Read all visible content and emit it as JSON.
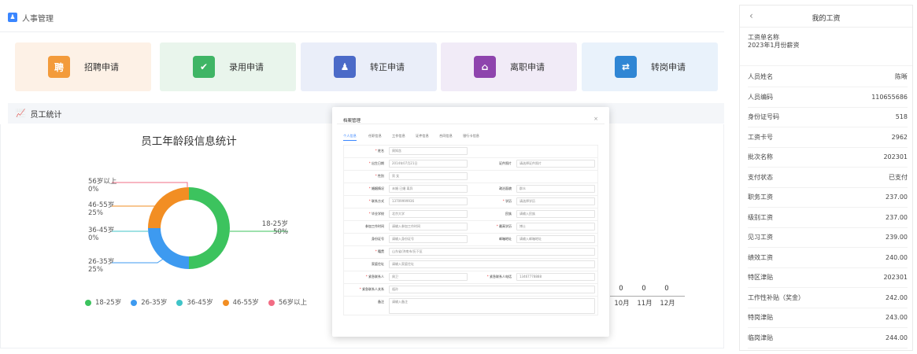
{
  "header": {
    "title": "人事管理"
  },
  "cards": [
    {
      "label": "招聘申请",
      "icon": "聘",
      "icon_name": "recruit-icon",
      "bg": "#fdf1e6",
      "color": "#f39b3b"
    },
    {
      "label": "录用申请",
      "icon": "✔",
      "icon_name": "check-icon",
      "bg": "#e9f5ec",
      "color": "#3fb565"
    },
    {
      "label": "转正申请",
      "icon": "♟",
      "icon_name": "user-icon",
      "bg": "#eaeef9",
      "color": "#4b6ac8"
    },
    {
      "label": "离职申请",
      "icon": "⌂",
      "icon_name": "leave-icon",
      "bg": "#f1ebf7",
      "color": "#8e44ad"
    },
    {
      "label": "转岗申请",
      "icon": "⇄",
      "icon_name": "transfer-icon",
      "bg": "#e9f2fb",
      "color": "#2f86d4"
    }
  ],
  "section": {
    "title": "员工统计"
  },
  "donut": {
    "title": "员工年龄段信息统计"
  },
  "chart_data": [
    {
      "type": "pie",
      "title": "员工年龄段信息统计",
      "categories": [
        "18-25岁",
        "26-35岁",
        "36-45岁",
        "46-55岁",
        "56岁以上"
      ],
      "values": [
        50,
        25,
        0,
        25,
        0
      ],
      "colors": [
        "#3cc35e",
        "#3d9af0",
        "#40c4c8",
        "#f28e23",
        "#f26c84"
      ],
      "labels": [
        {
          "name": "56岁以上",
          "pct": "0%"
        },
        {
          "name": "46-55岁",
          "pct": "25%"
        },
        {
          "name": "36-45岁",
          "pct": "0%"
        },
        {
          "name": "26-35岁",
          "pct": "25%"
        },
        {
          "name": "18-25岁",
          "pct": "50%"
        }
      ]
    },
    {
      "type": "bar",
      "categories": [
        "10月",
        "11月",
        "12月"
      ],
      "values": [
        0,
        0,
        0
      ]
    }
  ],
  "modal": {
    "title": "档案管理",
    "tabs": [
      "个人信息",
      "任职信息",
      "工作信息",
      "证件信息",
      "合同信息",
      "银行卡信息"
    ],
    "fields": [
      {
        "label": "姓名",
        "value": "周知含",
        "req": true
      },
      {
        "label": "出生日期",
        "value": "2014年07月21日",
        "req": true
      },
      {
        "label": "证件照片",
        "value": "请选择证件照片",
        "req": false
      },
      {
        "label": "性别",
        "value": "男   女",
        "req": true
      },
      {
        "label": "婚姻情况",
        "value": "未婚    已婚    离异",
        "req": true
      },
      {
        "label": "政治面貌",
        "value": "群众",
        "req": false
      },
      {
        "label": "联系方式",
        "value": "13709999936",
        "req": true
      },
      {
        "label": "学历",
        "value": "请选择学历",
        "req": true
      },
      {
        "label": "毕业学校",
        "value": "北京大学",
        "req": true
      },
      {
        "label": "民族",
        "value": "请输入民族",
        "req": false
      },
      {
        "label": "参加工作时间",
        "value": "请输入参加工作时间",
        "req": false
      },
      {
        "label": "最高学历",
        "value": "博士",
        "req": true
      },
      {
        "label": "身份证号",
        "value": "请输入身份证号",
        "req": false
      },
      {
        "label": "邮箱地址",
        "value": "请输入邮箱地址",
        "req": false
      },
      {
        "label": "籍贯",
        "value": "山东省/济南市/历下区",
        "req": true
      },
      {
        "label": "家庭住址",
        "value": "请输入家庭住址",
        "req": false
      },
      {
        "label": "紧急联系人",
        "value": "周卫",
        "req": true
      },
      {
        "label": "紧急联系人电话",
        "value": "13467778888",
        "req": true
      },
      {
        "label": "紧急联系人关系",
        "value": "祖孙",
        "req": true
      },
      {
        "label": "备注",
        "value": "请输入备注",
        "req": false
      }
    ]
  },
  "salary": {
    "title": "我的工资",
    "sheet_label": "工资单名称",
    "sheet_name": "2023年1月份薪资",
    "rows": [
      {
        "label": "人员姓名",
        "value": "陈晰"
      },
      {
        "label": "人员编码",
        "value": "110655686"
      },
      {
        "label": "身份证号码",
        "value": "518"
      },
      {
        "label": "工资卡号",
        "value": "2962"
      },
      {
        "label": "批次名称",
        "value": "202301"
      },
      {
        "label": "支付状态",
        "value": "已支付"
      },
      {
        "label": "职务工资",
        "value": "237.00"
      },
      {
        "label": "级别工资",
        "value": "237.00"
      },
      {
        "label": "见习工资",
        "value": "239.00"
      },
      {
        "label": "绩效工资",
        "value": "240.00"
      },
      {
        "label": "特区津贴",
        "value": "202301"
      },
      {
        "label": "工作性补贴（奖金）",
        "value": "242.00"
      },
      {
        "label": "特岗津贴",
        "value": "243.00"
      },
      {
        "label": "临岗津贴",
        "value": "244.00"
      }
    ]
  }
}
